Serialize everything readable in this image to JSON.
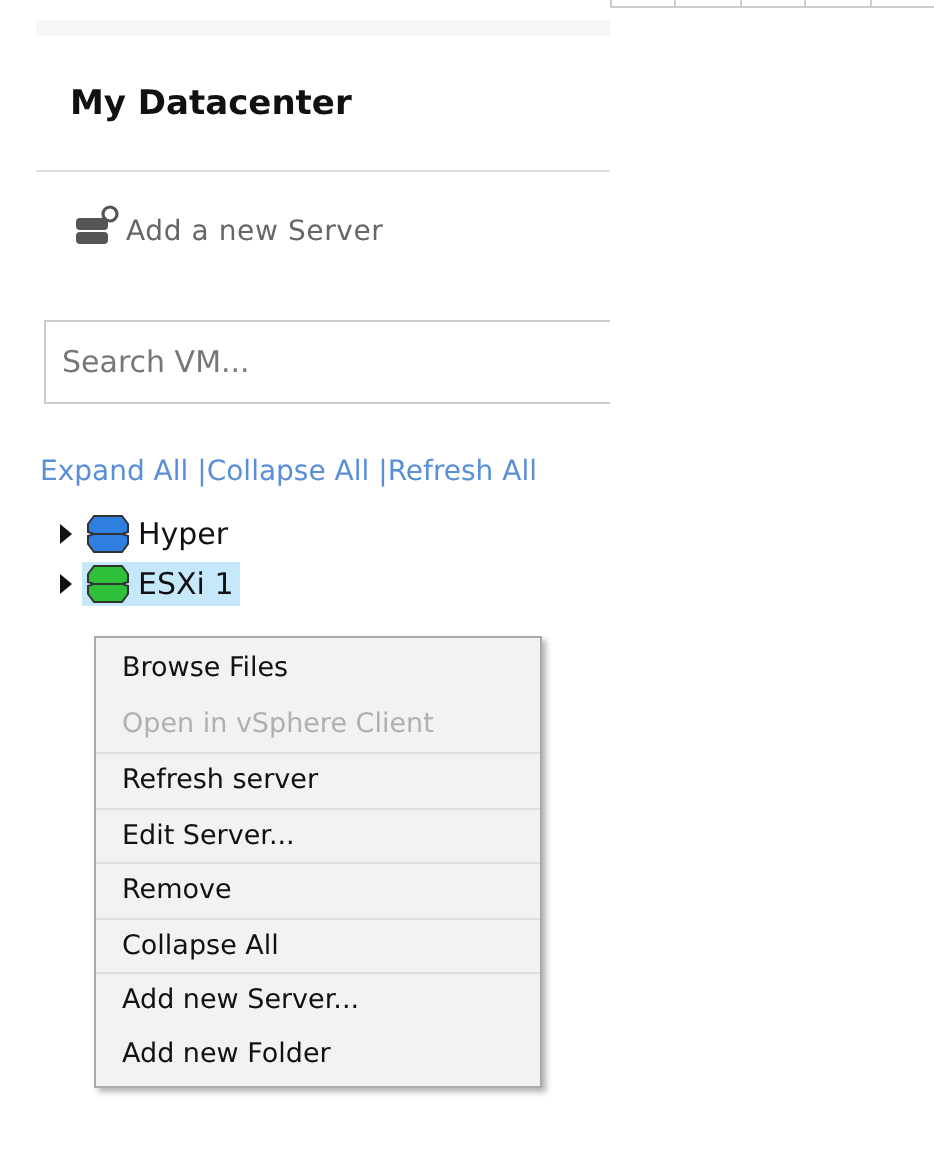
{
  "panel": {
    "title": "My Datacenter",
    "add_server": "Add a new Server",
    "search": {
      "placeholder": "Search VM..."
    },
    "links": [
      "Expand All |",
      "Collapse All |",
      "Refresh All"
    ]
  },
  "tree": [
    {
      "label": "Hyper",
      "color": "#2f7fe0",
      "selected": false,
      "expanded": false
    },
    {
      "label": "ESXi 1",
      "color": "#2fc03a",
      "selected": true,
      "expanded": false
    }
  ],
  "context_menu": [
    {
      "label": "Browse Files",
      "disabled": false,
      "divider_above": false
    },
    {
      "label": "Open in vSphere Client",
      "disabled": true,
      "divider_above": false
    },
    {
      "label": "Refresh server",
      "disabled": false,
      "divider_above": true
    },
    {
      "label": "Edit Server...",
      "disabled": false,
      "divider_above": true
    },
    {
      "label": "Remove",
      "disabled": false,
      "divider_above": true
    },
    {
      "label": "Collapse All",
      "disabled": false,
      "divider_above": true
    },
    {
      "label": "Add new Server...",
      "disabled": false,
      "divider_above": true
    },
    {
      "label": "Add new Folder",
      "disabled": false,
      "divider_above": false
    }
  ]
}
